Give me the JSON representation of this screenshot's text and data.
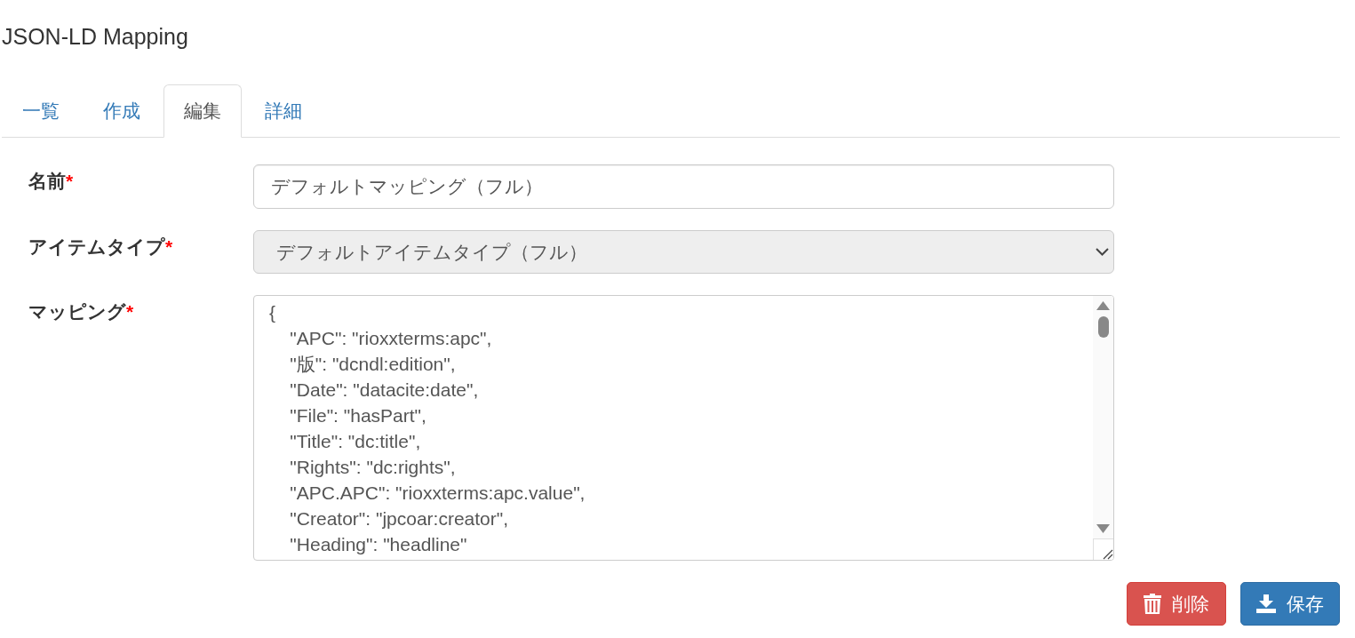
{
  "page": {
    "title": "JSON-LD Mapping"
  },
  "tabs": [
    {
      "label": "一覧",
      "selected": false
    },
    {
      "label": "作成",
      "selected": false
    },
    {
      "label": "編集",
      "selected": true
    },
    {
      "label": "詳細",
      "selected": false
    }
  ],
  "form": {
    "fields": [
      {
        "kind": "text",
        "label": "名前",
        "required_mark": "*",
        "value": "デフォルトマッピング（フル）",
        "disabled": false
      },
      {
        "kind": "select",
        "label": "アイテムタイプ",
        "required_mark": "*",
        "value": "デフォルトアイテムタイプ（フル）",
        "disabled": true
      },
      {
        "kind": "textarea",
        "label": "マッピング",
        "required_mark": "*",
        "value": "{\n    \"APC\": \"rioxxterms:apc\",\n    \"版\": \"dcndl:edition\",\n    \"Date\": \"datacite:date\",\n    \"File\": \"hasPart\",\n    \"Title\": \"dc:title\",\n    \"Rights\": \"dc:rights\",\n    \"APC.APC\": \"rioxxterms:apc.value\",\n    \"Creator\": \"jpcoar:creator\",\n    \"Heading\": \"headline\"",
        "disabled": false
      }
    ]
  },
  "buttons": [
    {
      "kind": "delete",
      "label": "削除"
    },
    {
      "kind": "save",
      "label": "保存"
    }
  ]
}
